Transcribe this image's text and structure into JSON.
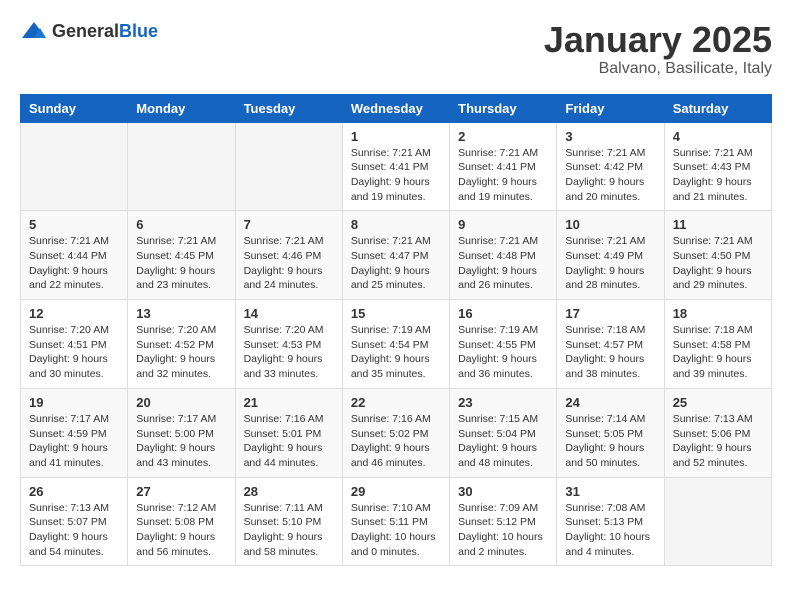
{
  "logo": {
    "general": "General",
    "blue": "Blue"
  },
  "header": {
    "month": "January 2025",
    "location": "Balvano, Basilicate, Italy"
  },
  "weekdays": [
    "Sunday",
    "Monday",
    "Tuesday",
    "Wednesday",
    "Thursday",
    "Friday",
    "Saturday"
  ],
  "weeks": [
    [
      {
        "day": "",
        "info": ""
      },
      {
        "day": "",
        "info": ""
      },
      {
        "day": "",
        "info": ""
      },
      {
        "day": "1",
        "info": "Sunrise: 7:21 AM\nSunset: 4:41 PM\nDaylight: 9 hours and 19 minutes."
      },
      {
        "day": "2",
        "info": "Sunrise: 7:21 AM\nSunset: 4:41 PM\nDaylight: 9 hours and 19 minutes."
      },
      {
        "day": "3",
        "info": "Sunrise: 7:21 AM\nSunset: 4:42 PM\nDaylight: 9 hours and 20 minutes."
      },
      {
        "day": "4",
        "info": "Sunrise: 7:21 AM\nSunset: 4:43 PM\nDaylight: 9 hours and 21 minutes."
      }
    ],
    [
      {
        "day": "5",
        "info": "Sunrise: 7:21 AM\nSunset: 4:44 PM\nDaylight: 9 hours and 22 minutes."
      },
      {
        "day": "6",
        "info": "Sunrise: 7:21 AM\nSunset: 4:45 PM\nDaylight: 9 hours and 23 minutes."
      },
      {
        "day": "7",
        "info": "Sunrise: 7:21 AM\nSunset: 4:46 PM\nDaylight: 9 hours and 24 minutes."
      },
      {
        "day": "8",
        "info": "Sunrise: 7:21 AM\nSunset: 4:47 PM\nDaylight: 9 hours and 25 minutes."
      },
      {
        "day": "9",
        "info": "Sunrise: 7:21 AM\nSunset: 4:48 PM\nDaylight: 9 hours and 26 minutes."
      },
      {
        "day": "10",
        "info": "Sunrise: 7:21 AM\nSunset: 4:49 PM\nDaylight: 9 hours and 28 minutes."
      },
      {
        "day": "11",
        "info": "Sunrise: 7:21 AM\nSunset: 4:50 PM\nDaylight: 9 hours and 29 minutes."
      }
    ],
    [
      {
        "day": "12",
        "info": "Sunrise: 7:20 AM\nSunset: 4:51 PM\nDaylight: 9 hours and 30 minutes."
      },
      {
        "day": "13",
        "info": "Sunrise: 7:20 AM\nSunset: 4:52 PM\nDaylight: 9 hours and 32 minutes."
      },
      {
        "day": "14",
        "info": "Sunrise: 7:20 AM\nSunset: 4:53 PM\nDaylight: 9 hours and 33 minutes."
      },
      {
        "day": "15",
        "info": "Sunrise: 7:19 AM\nSunset: 4:54 PM\nDaylight: 9 hours and 35 minutes."
      },
      {
        "day": "16",
        "info": "Sunrise: 7:19 AM\nSunset: 4:55 PM\nDaylight: 9 hours and 36 minutes."
      },
      {
        "day": "17",
        "info": "Sunrise: 7:18 AM\nSunset: 4:57 PM\nDaylight: 9 hours and 38 minutes."
      },
      {
        "day": "18",
        "info": "Sunrise: 7:18 AM\nSunset: 4:58 PM\nDaylight: 9 hours and 39 minutes."
      }
    ],
    [
      {
        "day": "19",
        "info": "Sunrise: 7:17 AM\nSunset: 4:59 PM\nDaylight: 9 hours and 41 minutes."
      },
      {
        "day": "20",
        "info": "Sunrise: 7:17 AM\nSunset: 5:00 PM\nDaylight: 9 hours and 43 minutes."
      },
      {
        "day": "21",
        "info": "Sunrise: 7:16 AM\nSunset: 5:01 PM\nDaylight: 9 hours and 44 minutes."
      },
      {
        "day": "22",
        "info": "Sunrise: 7:16 AM\nSunset: 5:02 PM\nDaylight: 9 hours and 46 minutes."
      },
      {
        "day": "23",
        "info": "Sunrise: 7:15 AM\nSunset: 5:04 PM\nDaylight: 9 hours and 48 minutes."
      },
      {
        "day": "24",
        "info": "Sunrise: 7:14 AM\nSunset: 5:05 PM\nDaylight: 9 hours and 50 minutes."
      },
      {
        "day": "25",
        "info": "Sunrise: 7:13 AM\nSunset: 5:06 PM\nDaylight: 9 hours and 52 minutes."
      }
    ],
    [
      {
        "day": "26",
        "info": "Sunrise: 7:13 AM\nSunset: 5:07 PM\nDaylight: 9 hours and 54 minutes."
      },
      {
        "day": "27",
        "info": "Sunrise: 7:12 AM\nSunset: 5:08 PM\nDaylight: 9 hours and 56 minutes."
      },
      {
        "day": "28",
        "info": "Sunrise: 7:11 AM\nSunset: 5:10 PM\nDaylight: 9 hours and 58 minutes."
      },
      {
        "day": "29",
        "info": "Sunrise: 7:10 AM\nSunset: 5:11 PM\nDaylight: 10 hours and 0 minutes."
      },
      {
        "day": "30",
        "info": "Sunrise: 7:09 AM\nSunset: 5:12 PM\nDaylight: 10 hours and 2 minutes."
      },
      {
        "day": "31",
        "info": "Sunrise: 7:08 AM\nSunset: 5:13 PM\nDaylight: 10 hours and 4 minutes."
      },
      {
        "day": "",
        "info": ""
      }
    ]
  ]
}
